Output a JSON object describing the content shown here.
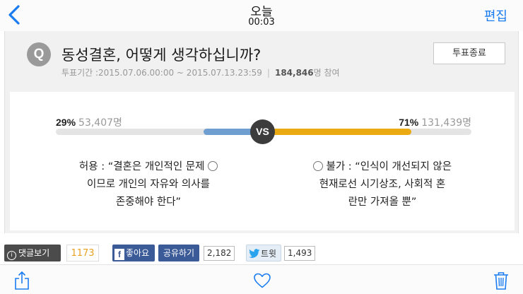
{
  "nav": {
    "title": "오늘",
    "subtitle": "00:03",
    "edit_label": "편집",
    "back_icon": "chevron-left-icon"
  },
  "poll": {
    "badge": "Q",
    "question": "동성결혼, 어떻게 생각하십니까?",
    "period": "투표기간 :2015.07.06.00:00 ~ 2015.07.13.23:59",
    "separator": "|",
    "participants": "184,846",
    "participants_suffix": "명 참여",
    "end_button": "투표종료",
    "vs_label": "VS",
    "left": {
      "percent_label": "29%",
      "percent": 29,
      "count": "53,407명",
      "option_lines": [
        "허용 : “결혼은 개인적인 문제",
        "이므로 개인의 자유와 의사를",
        "존중해야 한다”"
      ],
      "color": "#6f9fd0"
    },
    "right": {
      "percent_label": "71%",
      "percent": 71,
      "count": "131,439명",
      "option_lines": [
        "불가 : “인식이 개선되지 않은",
        "현재로선 시기상조, 사회적 혼",
        "란만 가져올 뿐”"
      ],
      "color": "#ecaa12"
    }
  },
  "social": {
    "comments_label": "댓글보기",
    "comments_count": "1173",
    "like_label": "좋아요",
    "share_label": "공유하기",
    "share_count": "2,182",
    "tweet_label": "트윗",
    "tweet_count": "1,493"
  },
  "toolbar": {
    "icons": [
      "share-icon",
      "heart-icon",
      "trash-icon"
    ],
    "tint": "#1a7cf0"
  }
}
